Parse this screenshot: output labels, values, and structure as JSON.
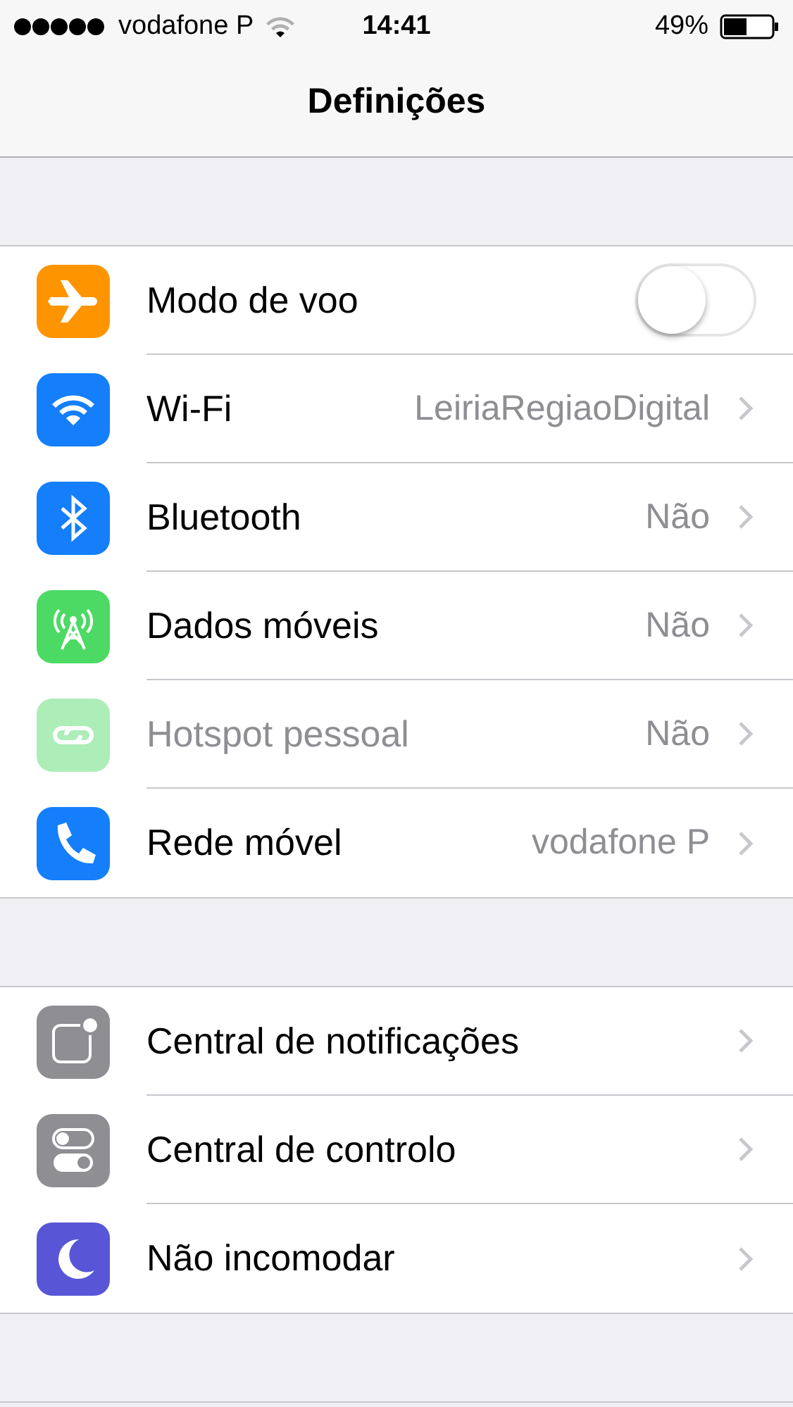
{
  "status_bar": {
    "carrier": "vodafone P",
    "time": "14:41",
    "battery": "49%"
  },
  "nav_bar": {
    "title": "Definições"
  },
  "groups": [
    {
      "items": [
        {
          "label": "Modo de voo",
          "kind": "toggle",
          "on": false,
          "disabled": false
        },
        {
          "label": "Wi-Fi",
          "kind": "link",
          "value": "LeiriaRegiaoDigital",
          "disabled": false
        },
        {
          "label": "Bluetooth",
          "kind": "link",
          "value": "Não",
          "disabled": false
        },
        {
          "label": "Dados móveis",
          "kind": "link",
          "value": "Não",
          "disabled": false
        },
        {
          "label": "Hotspot pessoal",
          "kind": "link",
          "value": "Não",
          "disabled": true
        },
        {
          "label": "Rede móvel",
          "kind": "link",
          "value": "vodafone P",
          "disabled": false
        }
      ]
    },
    {
      "items": [
        {
          "label": "Central de notificações",
          "kind": "link",
          "disabled": false
        },
        {
          "label": "Central de controlo",
          "kind": "link",
          "disabled": false
        },
        {
          "label": "Não incomodar",
          "kind": "link",
          "disabled": false
        }
      ]
    }
  ]
}
